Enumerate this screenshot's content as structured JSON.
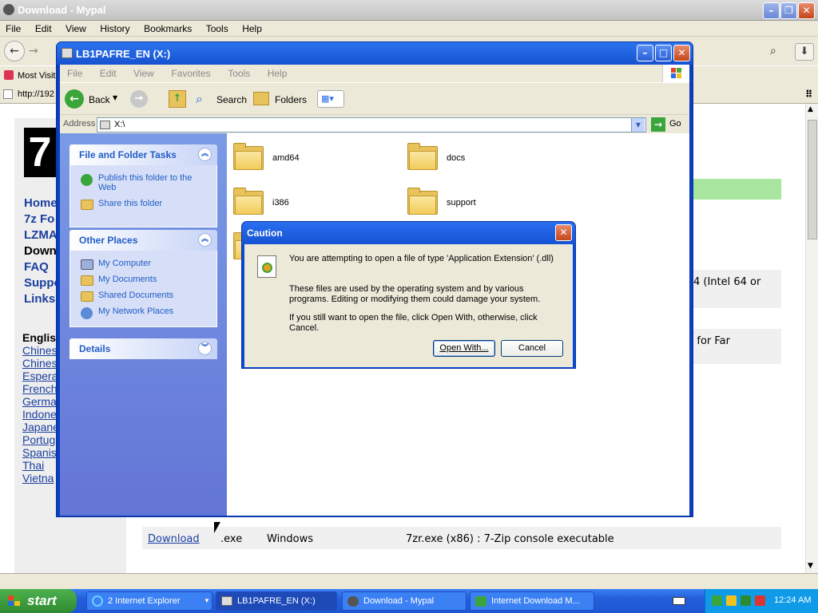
{
  "browser": {
    "title": "Download - Mypal",
    "menu": [
      "File",
      "Edit",
      "View",
      "History",
      "Bookmarks",
      "Tools",
      "Help"
    ],
    "bookmarks_label": "Most Visit",
    "tab_url": "http://192"
  },
  "website": {
    "logo_char": "7",
    "nav": [
      "Home",
      "7z Fo",
      "LZMA",
      "Down",
      "FAQ",
      "Suppo",
      "Links"
    ],
    "languages": [
      "English",
      "Chines",
      "Chines",
      "Espera",
      "French",
      "Germa",
      "Indone",
      "Japane",
      "Portug",
      "Spanis",
      "Thai",
      "Vietna"
    ],
    "row_fragments": {
      "intel": "4 (Intel 64 or",
      "far": "n for Far"
    },
    "last_row": {
      "link": "Download",
      "ext": ".exe",
      "os": "Windows",
      "desc": "7zr.exe (x86) : 7-Zip console executable"
    }
  },
  "explorer": {
    "title": "LB1PAFRE_EN (X:)",
    "menu": [
      "File",
      "Edit",
      "View",
      "Favorites",
      "Tools",
      "Help"
    ],
    "toolbar": {
      "back": "Back",
      "search": "Search",
      "folders": "Folders"
    },
    "address_label": "Address",
    "address_value": "X:\\",
    "go_label": "Go",
    "tasks_panel": {
      "title": "File and Folder Tasks",
      "items": [
        "Publish this folder to the Web",
        "Share this folder"
      ]
    },
    "places_panel": {
      "title": "Other Places",
      "items": [
        "My Computer",
        "My Documents",
        "Shared Documents",
        "My Network Places"
      ]
    },
    "details_panel": {
      "title": "Details"
    },
    "folders": [
      "amd64",
      "docs",
      "i386",
      "support"
    ]
  },
  "dialog": {
    "title": "Caution",
    "line1": "You are attempting to open a file of type 'Application Extension' (.dll)",
    "line2a": "These files are used by the operating system and by various",
    "line2b": "programs. Editing or modifying them could damage your system.",
    "line3a": "If you still want to open the file, click Open With, otherwise, click",
    "line3b": "Cancel.",
    "open_with": "Open With...",
    "cancel": "Cancel"
  },
  "taskbar": {
    "start": "start",
    "items": [
      "2 Internet Explorer",
      "LB1PAFRE_EN (X:)",
      "Download - Mypal",
      "Internet Download M..."
    ],
    "clock": "12:24 AM"
  },
  "colors": {
    "xp_blue": "#0a3fbd",
    "taskbar": "#245edb",
    "start_green": "#2e8a2f",
    "web_green": "#a8e6a0"
  }
}
